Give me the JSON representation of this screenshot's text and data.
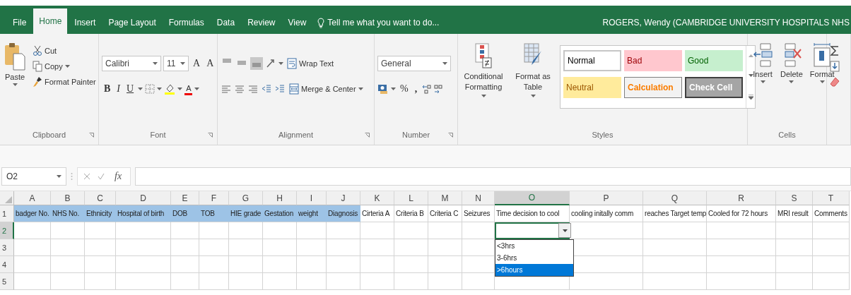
{
  "title_bar": {
    "tabs": [
      {
        "label": "File",
        "selected": false
      },
      {
        "label": "Home",
        "selected": true
      },
      {
        "label": "Insert",
        "selected": false
      },
      {
        "label": "Page Layout",
        "selected": false
      },
      {
        "label": "Formulas",
        "selected": false
      },
      {
        "label": "Data",
        "selected": false
      },
      {
        "label": "Review",
        "selected": false
      },
      {
        "label": "View",
        "selected": false
      }
    ],
    "tell_me": "Tell me what you want to do...",
    "user": "ROGERS, Wendy (CAMBRIDGE UNIVERSITY HOSPITALS NHS"
  },
  "ribbon": {
    "clipboard": {
      "paste": "Paste",
      "cut": "Cut",
      "copy": "Copy",
      "format_painter": "Format Painter",
      "label": "Clipboard"
    },
    "font": {
      "name": "Calibri",
      "size": "11",
      "grow": "A",
      "shrink": "A",
      "bold": "B",
      "italic": "I",
      "underline": "U",
      "font_color": "A",
      "label": "Font"
    },
    "alignment": {
      "vertical": [
        {
          "selected": false
        },
        {
          "selected": false
        },
        {
          "selected": true
        }
      ],
      "wrap_text": "Wrap Text",
      "merge_center": "Merge & Center",
      "label": "Alignment"
    },
    "number": {
      "format": "General",
      "percent": "%",
      "comma": ",",
      "label": "Number"
    },
    "styles": {
      "conditional_formatting": "Conditional Formatting",
      "format_as_table": "Format as Table",
      "cell_styles": [
        {
          "label": "Normal",
          "kind": "normal"
        },
        {
          "label": "Bad",
          "kind": "bad"
        },
        {
          "label": "Good",
          "kind": "good"
        },
        {
          "label": "Neutral",
          "kind": "neutral"
        },
        {
          "label": "Calculation",
          "kind": "calculation"
        },
        {
          "label": "Check Cell",
          "kind": "check"
        }
      ],
      "label": "Styles"
    },
    "cells": {
      "insert": "Insert",
      "delete": "Delete",
      "format": "Format",
      "label": "Cells"
    }
  },
  "formula_bar": {
    "name_box": "O2",
    "function_label": "fx"
  },
  "sheet": {
    "columns": [
      {
        "label": "A",
        "selected": false
      },
      {
        "label": "B",
        "selected": false
      },
      {
        "label": "C",
        "selected": false
      },
      {
        "label": "D",
        "selected": false
      },
      {
        "label": "E",
        "selected": false
      },
      {
        "label": "F",
        "selected": false
      },
      {
        "label": "G",
        "selected": false
      },
      {
        "label": "H",
        "selected": false
      },
      {
        "label": "I",
        "selected": false
      },
      {
        "label": "J",
        "selected": false
      },
      {
        "label": "K",
        "selected": false
      },
      {
        "label": "L",
        "selected": false
      },
      {
        "label": "M",
        "selected": false
      },
      {
        "label": "N",
        "selected": false
      },
      {
        "label": "O",
        "selected": true
      },
      {
        "label": "P",
        "selected": false
      },
      {
        "label": "Q",
        "selected": false
      },
      {
        "label": "R",
        "selected": false
      },
      {
        "label": "S",
        "selected": false
      },
      {
        "label": "T",
        "selected": false
      }
    ],
    "rows": [
      {
        "label": "1",
        "selected": false,
        "cells": [
          {
            "text": "badger No.",
            "filled": true
          },
          {
            "text": "NHS No.",
            "filled": true
          },
          {
            "text": "Ethnicity",
            "filled": true
          },
          {
            "text": "Hospital of birth",
            "filled": true
          },
          {
            "text": "DOB",
            "filled": true
          },
          {
            "text": "TOB",
            "filled": true
          },
          {
            "text": "HIE grade",
            "filled": true
          },
          {
            "text": "Gestation",
            "filled": true
          },
          {
            "text": "weight",
            "filled": true
          },
          {
            "text": "Diagnosis",
            "filled": true
          },
          {
            "text": "Cirteria A",
            "filled": false
          },
          {
            "text": "Criteria B",
            "filled": false
          },
          {
            "text": "Criteria C",
            "filled": false
          },
          {
            "text": "Seizures",
            "filled": false
          },
          {
            "text": "Time decision to cool",
            "filled": false
          },
          {
            "text": "cooling initally comm",
            "filled": false
          },
          {
            "text": "reaches Target temp",
            "filled": false
          },
          {
            "text": "Cooled for 72 hours",
            "filled": false
          },
          {
            "text": "MRI result",
            "filled": false
          },
          {
            "text": "Comments",
            "filled": false
          }
        ]
      },
      {
        "label": "2",
        "selected": true
      },
      {
        "label": "3",
        "selected": false
      },
      {
        "label": "4",
        "selected": false
      },
      {
        "label": "5",
        "selected": false
      }
    ],
    "dropdown": {
      "options": [
        {
          "label": "<3hrs",
          "selected": false
        },
        {
          "label": "3-6hrs",
          "selected": false
        },
        {
          "label": ">6hours",
          "selected": true
        }
      ]
    }
  }
}
